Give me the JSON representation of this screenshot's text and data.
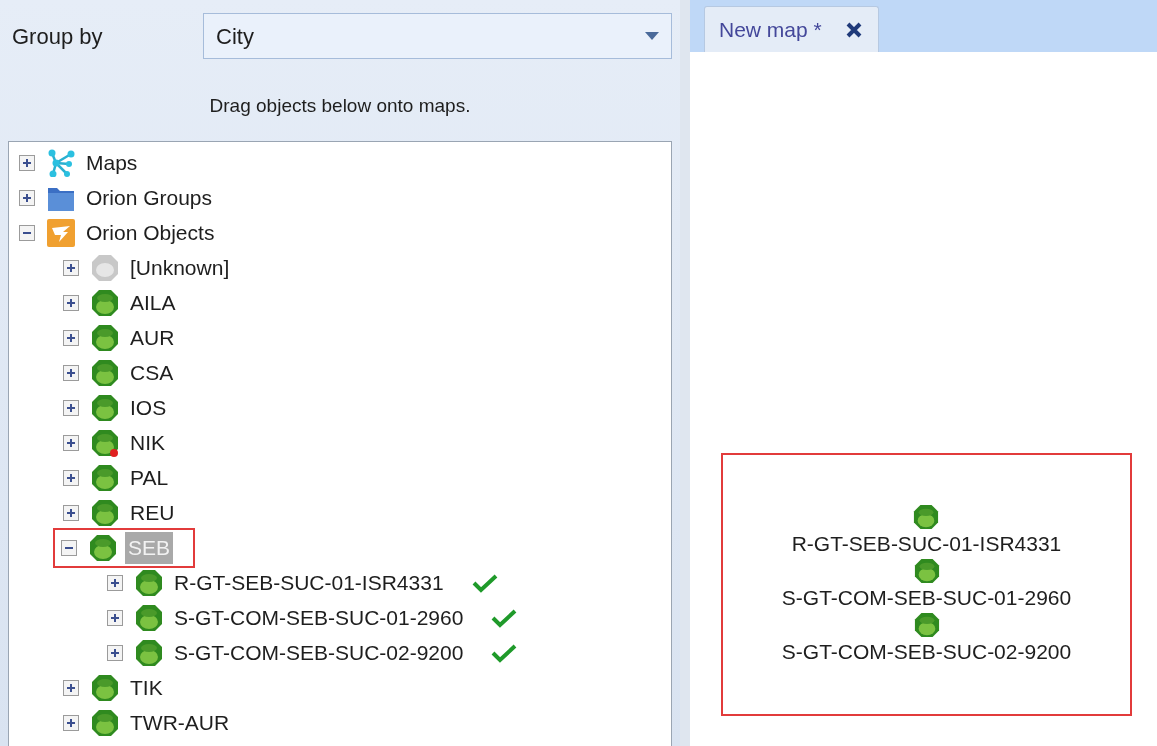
{
  "group_by": {
    "label": "Group by",
    "value": "City"
  },
  "hint": "Drag objects below onto maps.",
  "tree": [
    {
      "label": "Maps",
      "kind": "maps",
      "expanded": false,
      "selected": false,
      "annotated": false
    },
    {
      "label": "Orion Groups",
      "kind": "folder",
      "expanded": false,
      "selected": false,
      "annotated": false
    },
    {
      "label": "Orion Objects",
      "kind": "orion",
      "expanded": true,
      "selected": false,
      "annotated": false,
      "children": [
        {
          "label": "[Unknown]",
          "kind": "unknown",
          "expanded": false,
          "selected": false,
          "annotated": false
        },
        {
          "label": "AILA",
          "kind": "up",
          "expanded": false,
          "selected": false,
          "annotated": false
        },
        {
          "label": "AUR",
          "kind": "up",
          "expanded": false,
          "selected": false,
          "annotated": false
        },
        {
          "label": "CSA",
          "kind": "up",
          "expanded": false,
          "selected": false,
          "annotated": false
        },
        {
          "label": "IOS",
          "kind": "up",
          "expanded": false,
          "selected": false,
          "annotated": false
        },
        {
          "label": "NIK",
          "kind": "alert",
          "expanded": false,
          "selected": false,
          "annotated": false
        },
        {
          "label": "PAL",
          "kind": "up",
          "expanded": false,
          "selected": false,
          "annotated": false
        },
        {
          "label": "REU",
          "kind": "up",
          "expanded": false,
          "selected": false,
          "annotated": false
        },
        {
          "label": "SEB",
          "kind": "up",
          "expanded": true,
          "selected": true,
          "annotated": true,
          "children": [
            {
              "label": "R-GT-SEB-SUC-01-ISR4331",
              "kind": "up",
              "expanded": false,
              "selected": false,
              "annotated": false,
              "on_map": true
            },
            {
              "label": "S-GT-COM-SEB-SUC-01-2960",
              "kind": "up",
              "expanded": false,
              "selected": false,
              "annotated": false,
              "on_map": true
            },
            {
              "label": "S-GT-COM-SEB-SUC-02-9200",
              "kind": "up",
              "expanded": false,
              "selected": false,
              "annotated": false,
              "on_map": true
            }
          ]
        },
        {
          "label": "TIK",
          "kind": "up",
          "expanded": false,
          "selected": false,
          "annotated": false
        },
        {
          "label": "TWR-AUR",
          "kind": "up",
          "expanded": false,
          "selected": false,
          "annotated": false
        }
      ]
    }
  ],
  "tabs": [
    {
      "label": "New map *",
      "selected": true,
      "closable": true
    }
  ],
  "map": {
    "annotated": true,
    "nodes": [
      {
        "label": "R-GT-SEB-SUC-01-ISR4331",
        "kind": "up"
      },
      {
        "label": "S-GT-COM-SEB-SUC-01-2960",
        "kind": "up"
      },
      {
        "label": "S-GT-COM-SEB-SUC-02-9200",
        "kind": "up"
      }
    ]
  }
}
